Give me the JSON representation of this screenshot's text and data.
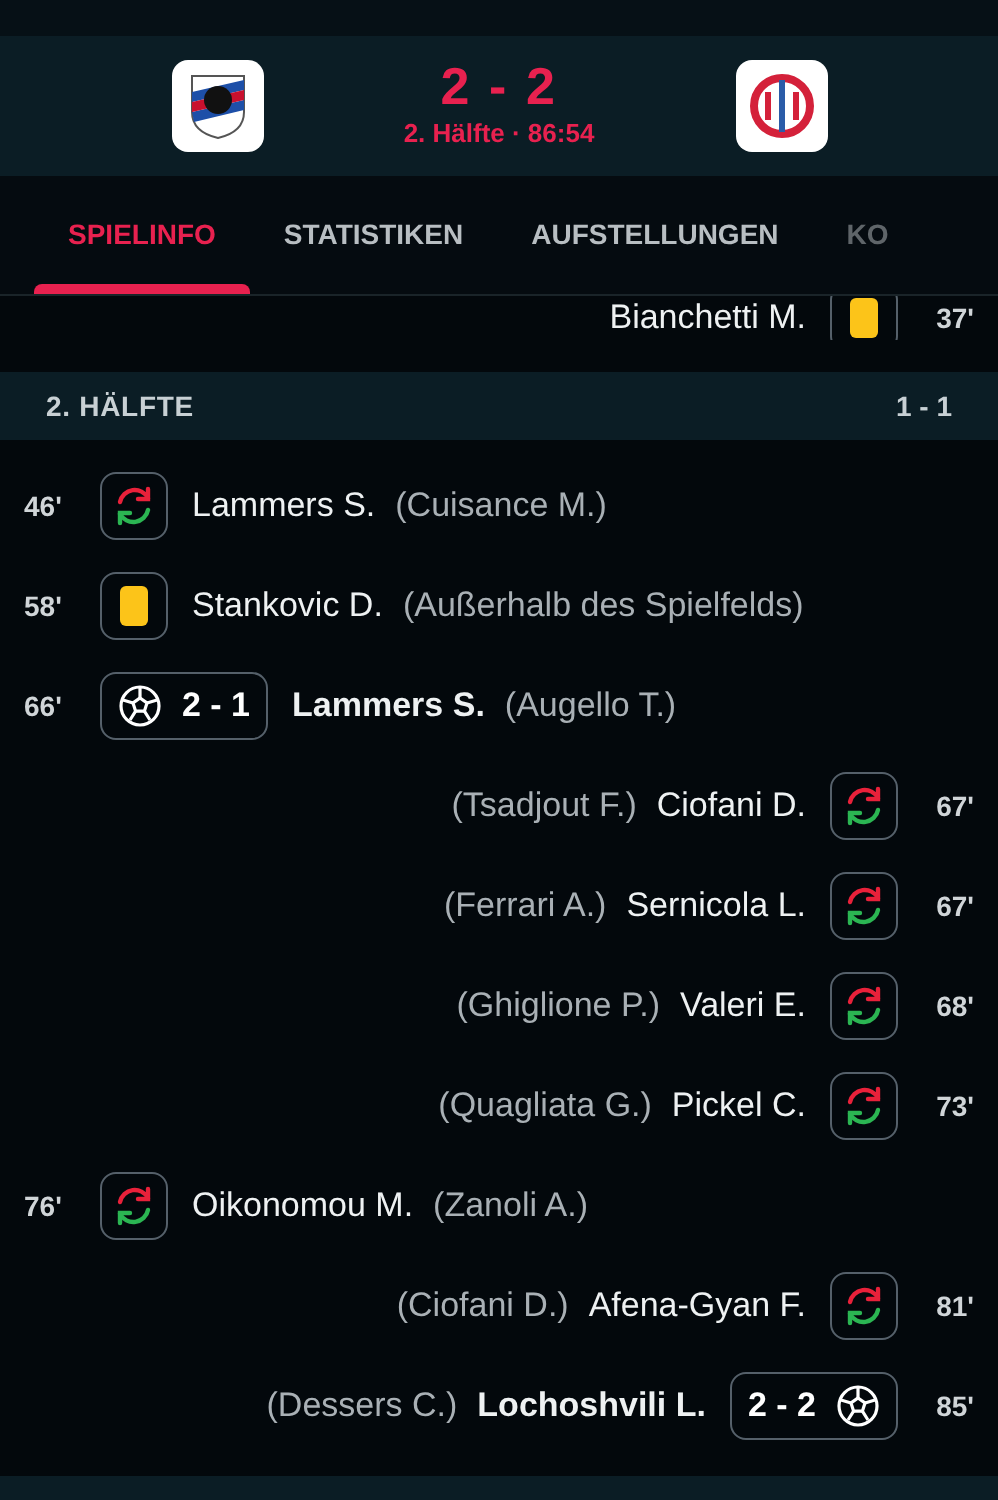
{
  "match": {
    "score": "2 - 2",
    "status": "2. Hälfte · 86:54"
  },
  "tabs": [
    {
      "label": "SPIELINFO",
      "selected": true
    },
    {
      "label": "STATISTIKEN",
      "selected": false
    },
    {
      "label": "AUFSTELLUNGEN",
      "selected": false
    },
    {
      "label": "KO",
      "selected": false
    }
  ],
  "previous_event": {
    "away": true,
    "kind": "yellow",
    "minute": "37'",
    "player": "Bianchetti M."
  },
  "section": {
    "title": "2. HÄLFTE",
    "score": "1 - 1"
  },
  "events": [
    {
      "away": false,
      "kind": "sub",
      "minute": "46'",
      "player": "Lammers S.",
      "detail": "(Cuisance M.)"
    },
    {
      "away": false,
      "kind": "yellow",
      "minute": "58'",
      "player": "Stankovic D.",
      "detail": "(Außerhalb des Spielfelds)"
    },
    {
      "away": false,
      "kind": "goal",
      "minute": "66'",
      "player": "Lammers S.",
      "detail": "(Augello T.)",
      "score": "2 - 1"
    },
    {
      "away": true,
      "kind": "sub",
      "minute": "67'",
      "player": "Ciofani D.",
      "detail": "(Tsadjout F.)"
    },
    {
      "away": true,
      "kind": "sub",
      "minute": "67'",
      "player": "Sernicola L.",
      "detail": "(Ferrari A.)"
    },
    {
      "away": true,
      "kind": "sub",
      "minute": "68'",
      "player": "Valeri E.",
      "detail": "(Ghiglione P.)"
    },
    {
      "away": true,
      "kind": "sub",
      "minute": "73'",
      "player": "Pickel C.",
      "detail": "(Quagliata G.)"
    },
    {
      "away": false,
      "kind": "sub",
      "minute": "76'",
      "player": "Oikonomou M.",
      "detail": "(Zanoli A.)"
    },
    {
      "away": true,
      "kind": "sub",
      "minute": "81'",
      "player": "Afena-Gyan F.",
      "detail": "(Ciofani D.)"
    },
    {
      "away": true,
      "kind": "goal",
      "minute": "85'",
      "player": "Lochoshvili L.",
      "detail": "(Dessers C.)",
      "score": "2 - 2"
    }
  ]
}
